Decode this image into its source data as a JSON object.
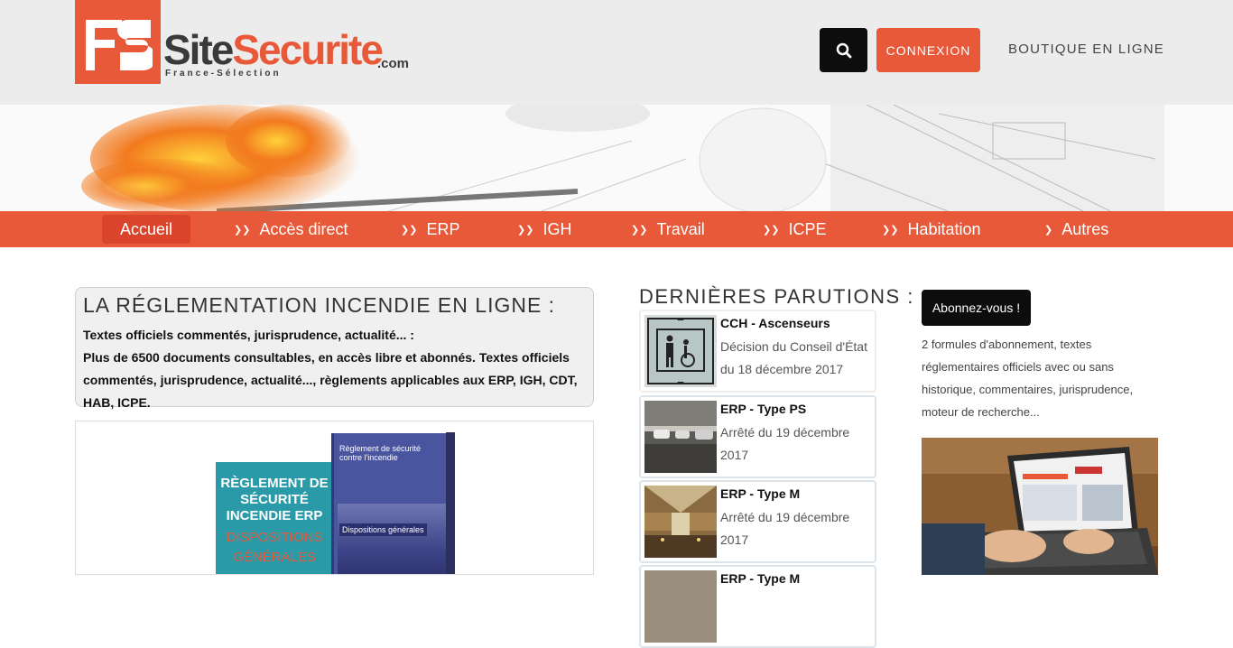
{
  "header": {
    "logo": {
      "site": "Site",
      "securite": "Securite",
      "com": ".com",
      "tagline": "France-Sélection"
    },
    "search_icon": "search-icon",
    "connexion_label": "CONNEXION",
    "boutique_label": "BOUTIQUE EN LIGNE"
  },
  "nav": {
    "items": [
      {
        "label": "Accueil",
        "icon": ""
      },
      {
        "label": "Accès direct",
        "icon": "chevron-down-icon"
      },
      {
        "label": "ERP",
        "icon": "chevron-down-icon"
      },
      {
        "label": "IGH",
        "icon": "chevron-down-icon"
      },
      {
        "label": "Travail",
        "icon": "chevron-down-icon"
      },
      {
        "label": "ICPE",
        "icon": "chevron-down-icon"
      },
      {
        "label": "Habitation",
        "icon": "chevron-down-icon"
      },
      {
        "label": "Autres",
        "icon": "chevron-right-icon"
      }
    ]
  },
  "intro": {
    "title": "LA RÉGLEMENTATION INCENDIE EN LIGNE :",
    "line1": "Textes officiels commentés, jurisprudence, actualité... :",
    "line2": "Plus de 6500 documents consultables, en accès libre et abonnés. Textes officiels commentés, jurisprudence, actualité..., règlements applicables aux ERP, IGH, CDT, HAB, ICPE."
  },
  "books": {
    "book1_title": "RÈGLEMENT DE SÉCURITÉ INCENDIE ERP",
    "book1_sub": "DISPOSITIONS GÉNÉRALES",
    "book2_title": "Règlement de sécurité contre l'incendie",
    "book2_sub": "Dispositions générales"
  },
  "parutions": {
    "title": "DERNIÈRES PARUTIONS :",
    "items": [
      {
        "title": "CCH - Ascenseurs",
        "desc": "Décision du Conseil d'État du 18 décembre 2017"
      },
      {
        "title": "ERP - Type PS",
        "desc": "Arrêté du 19 décembre 2017"
      },
      {
        "title": "ERP - Type M",
        "desc": "Arrêté du 19 décembre 2017"
      },
      {
        "title": "ERP - Type M",
        "desc": ""
      }
    ]
  },
  "abonnement": {
    "button_label": "Abonnez-vous !",
    "text": "2 formules d'abonnement, textes réglementaires officiels avec ou sans historique, commentaires, jurisprudence, moteur de recherche..."
  },
  "colors": {
    "accent": "#e8593a",
    "dark": "#0d0d0d",
    "header_bg": "#ececec"
  }
}
